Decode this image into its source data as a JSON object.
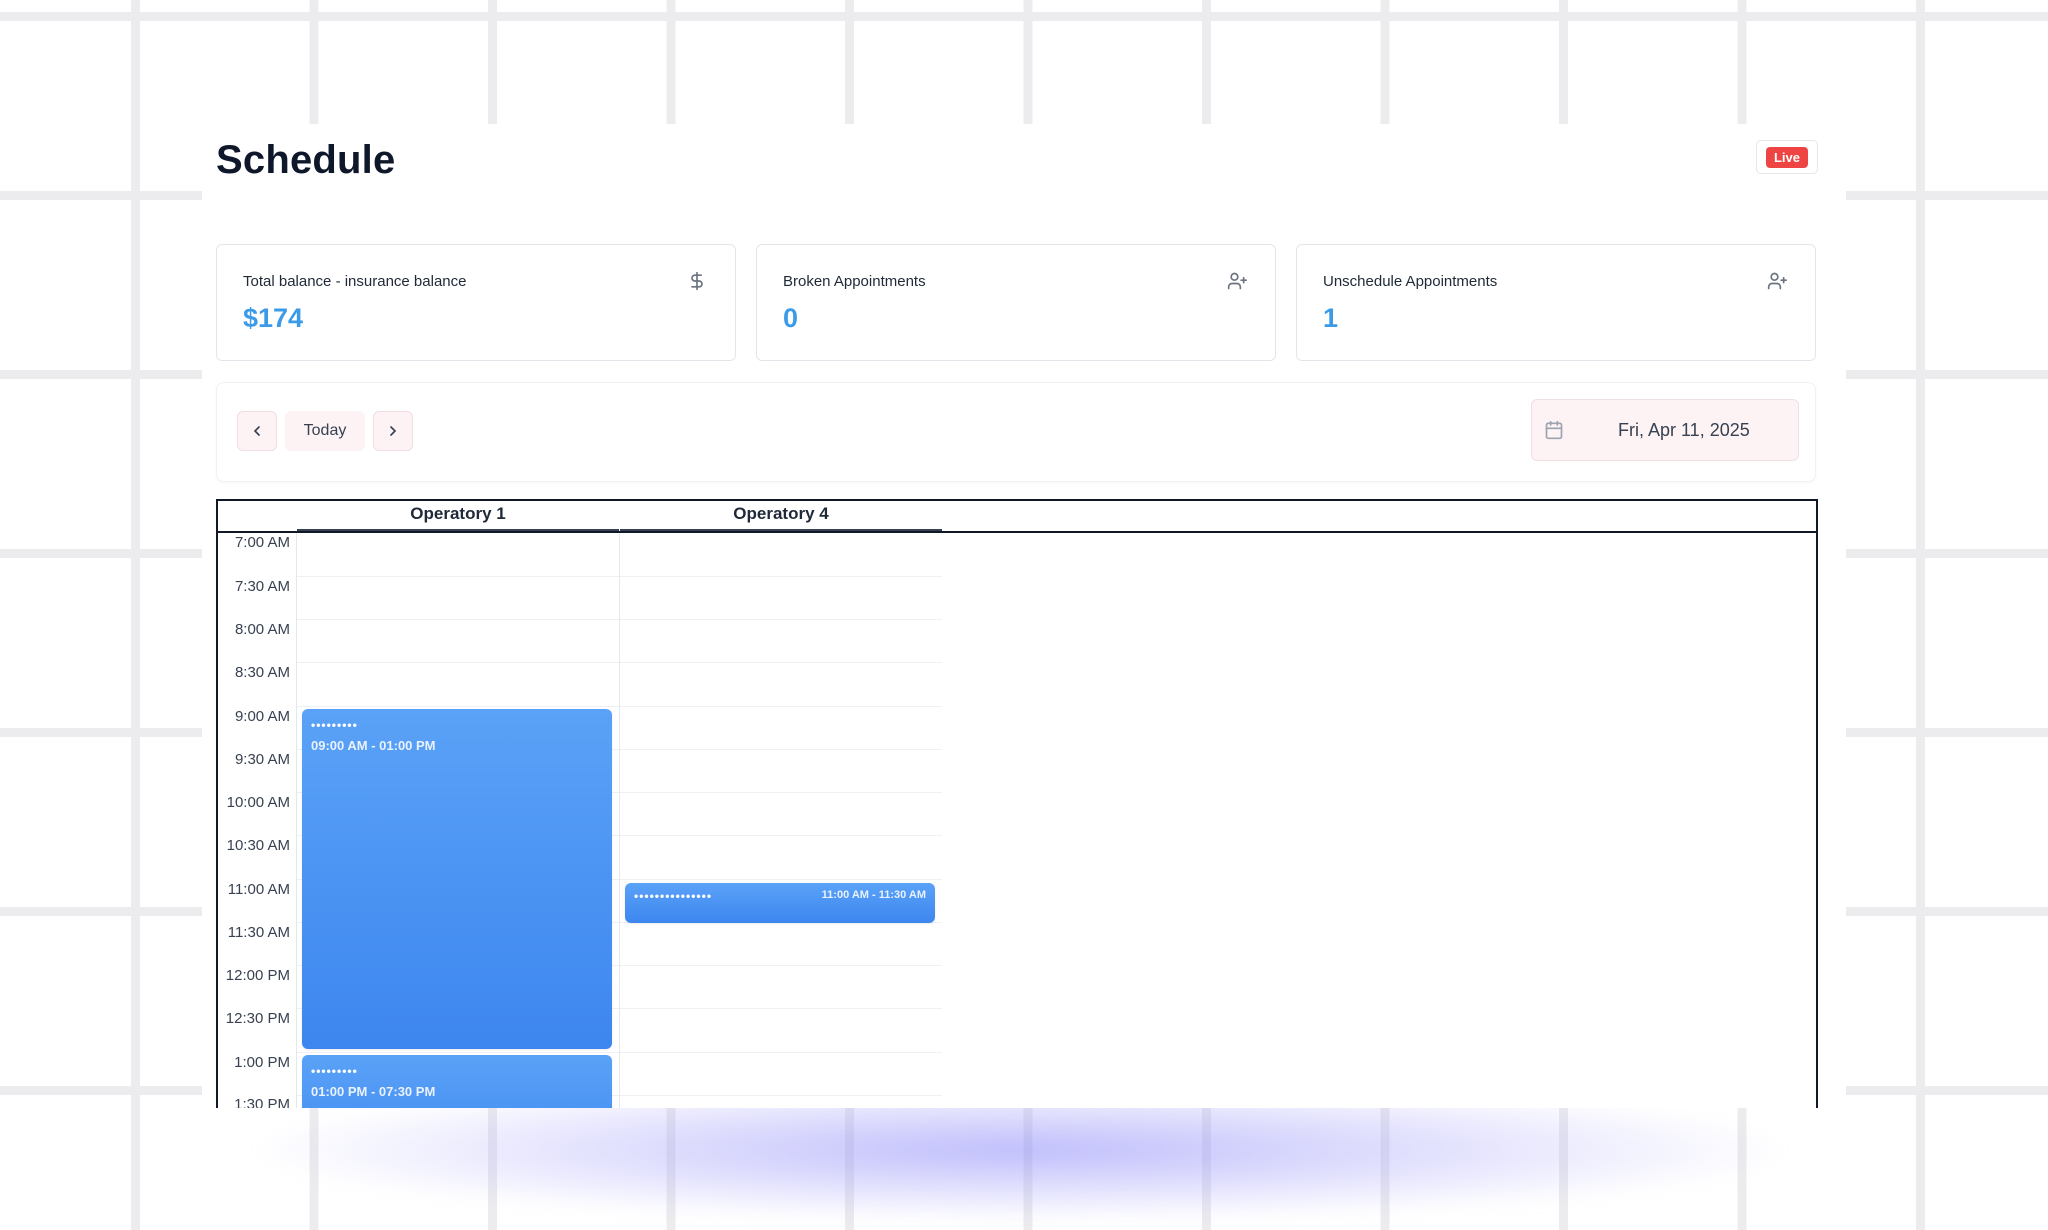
{
  "page": {
    "title": "Schedule",
    "badge": "Live"
  },
  "stats": [
    {
      "label": "Total balance - insurance balance",
      "value": "$174",
      "icon": "dollar-icon"
    },
    {
      "label": "Broken Appointments",
      "value": "0",
      "icon": "user-plus-icon"
    },
    {
      "label": "Unschedule Appointments",
      "value": "1",
      "icon": "user-plus-icon"
    }
  ],
  "toolbar": {
    "prev_icon": "chevron-left-icon",
    "today_label": "Today",
    "next_icon": "chevron-right-icon",
    "calendar_icon": "calendar-icon",
    "date": "Fri, Apr 11, 2025"
  },
  "calendar": {
    "columns": [
      "Operatory 1",
      "Operatory 4"
    ],
    "times": [
      "7:00 AM",
      "7:30 AM",
      "8:00 AM",
      "8:30 AM",
      "9:00 AM",
      "9:30 AM",
      "10:00 AM",
      "10:30 AM",
      "11:00 AM",
      "11:30 AM",
      "12:00 PM",
      "12:30 PM",
      "1:00 PM",
      "1:30 PM"
    ],
    "appointments": [
      {
        "operatory": "Operatory 1",
        "patient": "•••••••••",
        "time": "09:00 AM - 01:00 PM"
      },
      {
        "operatory": "Operatory 1",
        "patient": "•••••••••",
        "time": "01:00 PM - 07:30 PM"
      },
      {
        "operatory": "Operatory 4",
        "patient": "•••••••••••••••",
        "time": "11:00 AM - 11:30 AM"
      }
    ]
  },
  "colors": {
    "accent": "#3b9be9",
    "appointment": "#4a93f3",
    "badge": "#ef4444"
  }
}
